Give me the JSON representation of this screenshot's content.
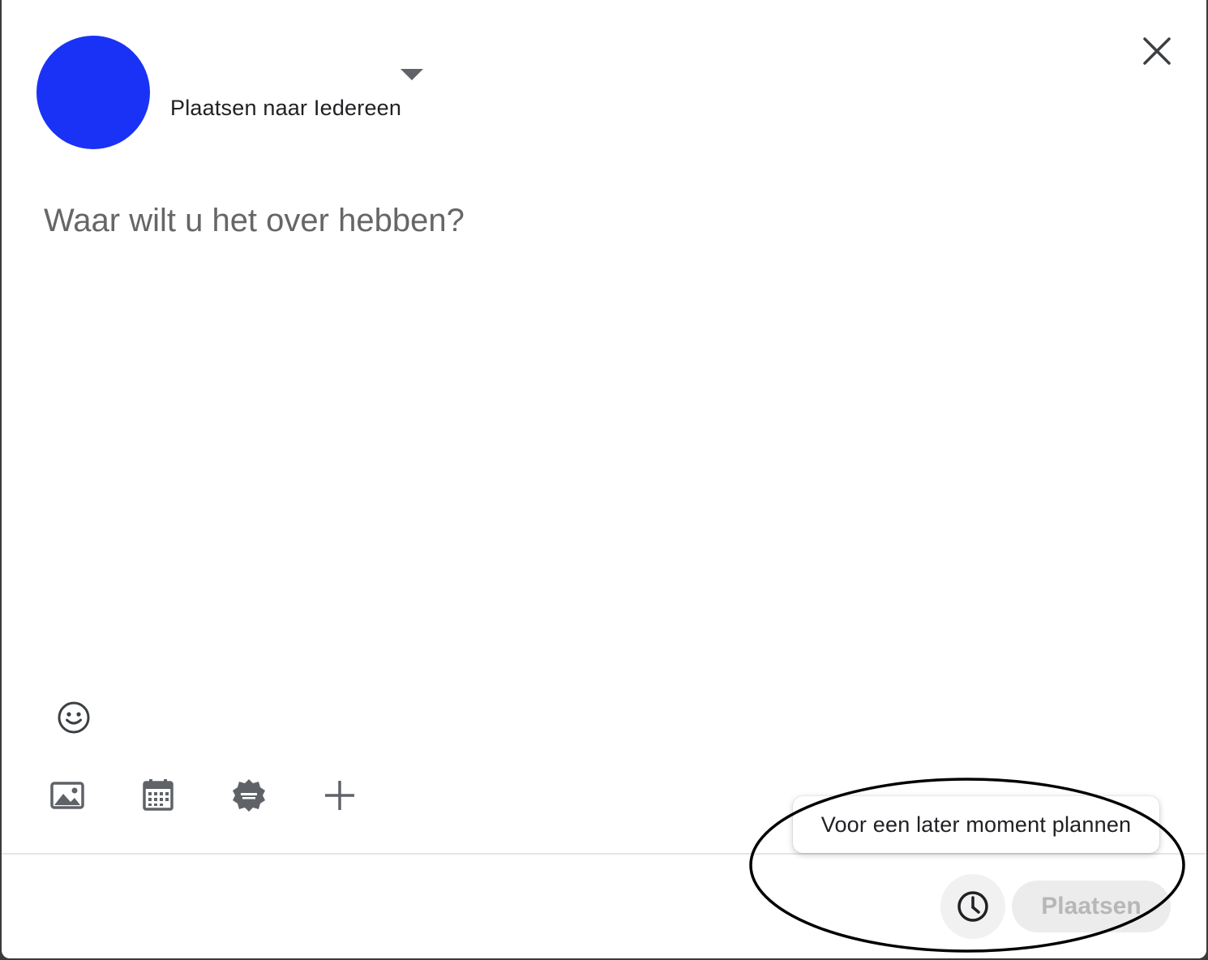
{
  "header": {
    "audience_label": "Plaatsen naar Iedereen"
  },
  "composer": {
    "placeholder": "Waar wilt u het over hebben?"
  },
  "toolbar": {
    "emoji": "smiley-icon",
    "tools": [
      "image-icon",
      "calendar-icon",
      "offer-badge-icon",
      "plus-icon"
    ]
  },
  "footer": {
    "schedule_tooltip": "Voor een later moment plannen",
    "schedule_icon": "clock-icon",
    "post_label": "Plaatsen"
  },
  "colors": {
    "avatar": "#1a32f5",
    "icon": "#5f6368",
    "post_disabled_bg": "#ececec",
    "post_disabled_text": "#b7b7b7"
  }
}
